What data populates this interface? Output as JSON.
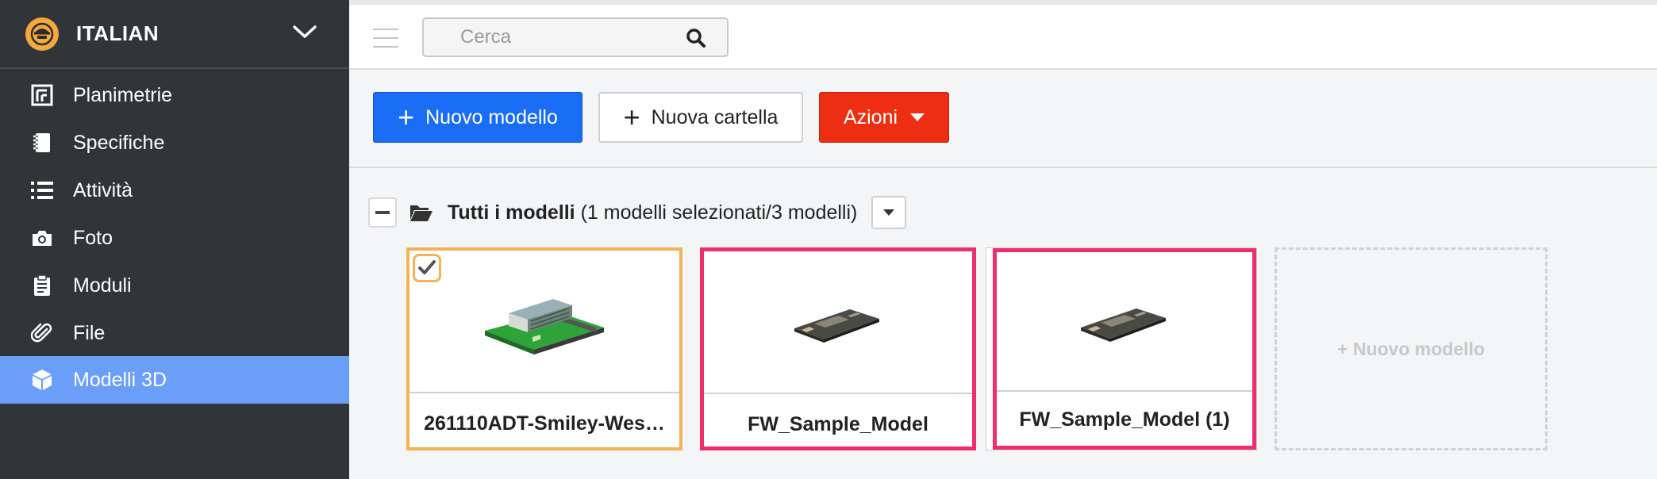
{
  "sidebar": {
    "title": "ITALIAN",
    "items": [
      {
        "label": "Planimetrie",
        "icon": "floorplan-icon"
      },
      {
        "label": "Specifiche",
        "icon": "notebook-icon"
      },
      {
        "label": "Attività",
        "icon": "list-icon"
      },
      {
        "label": "Foto",
        "icon": "camera-icon"
      },
      {
        "label": "Moduli",
        "icon": "clipboard-icon"
      },
      {
        "label": "File",
        "icon": "paperclip-icon"
      },
      {
        "label": "Modelli 3D",
        "icon": "cube-icon",
        "active": true
      }
    ]
  },
  "search": {
    "placeholder": "Cerca"
  },
  "toolbar": {
    "new_model_label": "Nuovo modello",
    "new_folder_label": "Nuova cartella",
    "actions_label": "Azioni"
  },
  "folder": {
    "name": "Tutti i modelli",
    "summary": "(1 modelli selezionati/3 modelli)"
  },
  "models": [
    {
      "name": "261110ADT-Smiley-Wes…",
      "selected": true
    },
    {
      "name": "FW_Sample_Model",
      "selected": false
    },
    {
      "name": "FW_Sample_Model (1)",
      "selected": false
    }
  ],
  "new_model_card_label": "+ Nuovo modello",
  "colors": {
    "sidebar_bg": "#323537",
    "active_item": "#6a9ef9",
    "primary": "#1a6ef5",
    "danger": "#ee2e12",
    "selected_border": "#f4b256",
    "highlight_border": "#ec2f6a"
  }
}
